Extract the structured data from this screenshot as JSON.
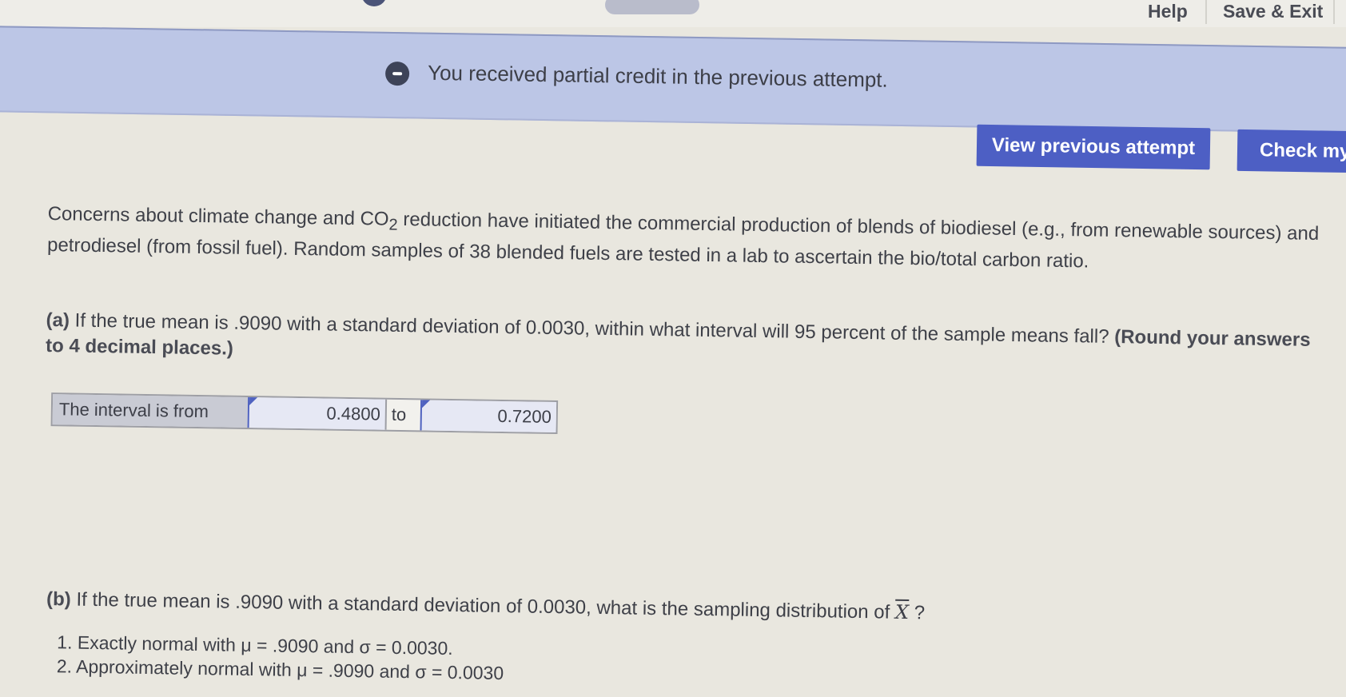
{
  "topbar": {
    "help_label": "Help",
    "save_exit_label": "Save & Exit"
  },
  "banner": {
    "message": "You received partial credit in the previous attempt."
  },
  "buttons": {
    "view_previous": "View previous attempt",
    "check_my_work": "Check my"
  },
  "question": {
    "intro_pre": "Concerns about climate change and CO",
    "intro_sub": "2",
    "intro_post": " reduction have initiated the commercial production of blends of biodiesel (e.g., from renewable sources) and petrodiesel (from fossil fuel). Random samples of 38 blended fuels are tested in a lab to ascertain the bio/total carbon ratio.",
    "part_a": {
      "label": "(a)",
      "text": " If the true mean is .9090 with a standard deviation of 0.0030, within what interval will 95 percent of the sample means fall? ",
      "instruction": "(Round your answers to 4 decimal places.)",
      "table": {
        "prefix": "The interval is from",
        "value_from": "0.4800",
        "separator": "to",
        "value_to": "0.7200"
      }
    },
    "part_b": {
      "label": "(b)",
      "text": " If the true mean is .9090 with a standard deviation of 0.0030, what is the sampling distribution of ",
      "symbol": "X",
      "suffix": " ?",
      "options": [
        "1. Exactly normal with μ = .9090 and σ = 0.0030.",
        "2. Approximately normal with μ = .9090 and σ = 0.0030"
      ]
    }
  },
  "colors": {
    "accent": "#4d5fc4",
    "banner_bg": "#bcc6e6",
    "page_bg": "#e9e7df"
  }
}
